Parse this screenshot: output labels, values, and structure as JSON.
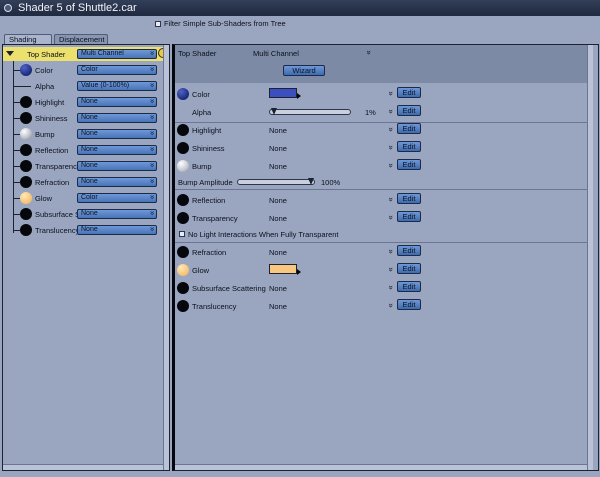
{
  "window": {
    "title": "Shader 5 of Shuttle2.car"
  },
  "filter": {
    "label": "Filter Simple Sub-Shaders from Tree"
  },
  "tabs": [
    {
      "label": "Shading"
    },
    {
      "label": "Displacement"
    }
  ],
  "tree": {
    "top": {
      "label": "Top Shader",
      "value": "Multi Channel"
    },
    "items": [
      {
        "label": "Color",
        "value": "Color"
      },
      {
        "label": "Alpha",
        "value": "Value (0-100%)"
      },
      {
        "label": "Highlight",
        "value": "None"
      },
      {
        "label": "Shininess",
        "value": "None"
      },
      {
        "label": "Bump",
        "value": "None"
      },
      {
        "label": "Reflection",
        "value": "None"
      },
      {
        "label": "Transparency",
        "value": "None"
      },
      {
        "label": "Refraction",
        "value": "None"
      },
      {
        "label": "Glow",
        "value": "Color"
      },
      {
        "label": "Subsurface Scattering",
        "value": "None"
      },
      {
        "label": "Translucency",
        "value": "None"
      }
    ]
  },
  "panel": {
    "top_label": "Top Shader",
    "top_value": "Multi Channel",
    "wizard": "Wizard",
    "edit": "Edit",
    "rows": {
      "color": {
        "label": "Color"
      },
      "alpha": {
        "label": "Alpha",
        "value": "1%",
        "level": 0.01
      },
      "highlight": {
        "label": "Highlight",
        "value": "None"
      },
      "shininess": {
        "label": "Shininess",
        "value": "None"
      },
      "bump": {
        "label": "Bump",
        "value": "None"
      },
      "bump_amp": {
        "label": "Bump Amplitude",
        "value": "100%",
        "level": 1.0
      },
      "reflection": {
        "label": "Reflection",
        "value": "None"
      },
      "transparency": {
        "label": "Transparency",
        "value": "None"
      },
      "nolight": {
        "label": "No Light Interactions When Fully Transparent"
      },
      "refraction": {
        "label": "Refraction",
        "value": "None"
      },
      "glow": {
        "label": "Glow"
      },
      "subsurface": {
        "label": "Subsurface Scattering",
        "value": "None"
      },
      "translucency": {
        "label": "Translucency",
        "value": "None"
      }
    }
  },
  "colors": {
    "color_swatch": "#3b4fbf",
    "glow_swatch": "#f8c880",
    "top_row_bg": "#ece06e"
  },
  "icons": {
    "window": "window-icon",
    "expand": "expand-triangle-icon",
    "top_ball": "sphere-icon",
    "dropdown": "chevron-down-icon"
  }
}
